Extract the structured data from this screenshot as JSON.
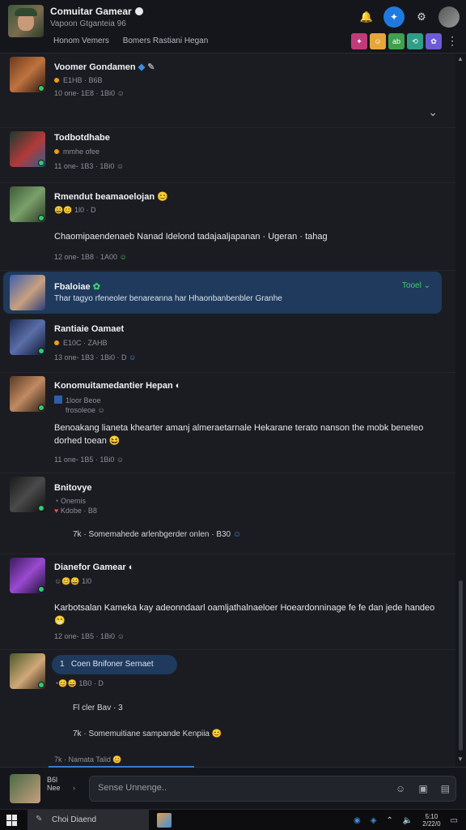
{
  "header": {
    "title": "Comuitar Gamear",
    "subtitle": "Vapoon Gtganteia 96",
    "tabs": [
      "Honom Vemers",
      "Bomers Rastiani Hegan"
    ],
    "apps": [
      {
        "label": "✦",
        "color": "#c13b7a"
      },
      {
        "label": "☺",
        "color": "#e6a63a"
      },
      {
        "label": "ab",
        "color": "#3fa14e"
      },
      {
        "label": "⟲",
        "color": "#2f9e86"
      },
      {
        "label": "✿",
        "color": "#6b5bd6"
      }
    ]
  },
  "messages": [
    {
      "name": "Voomer Gondamen",
      "meta": "E1HB · B6B",
      "time": "10 one- 1E8 · 1Bi0"
    },
    {
      "name": "Todbotdhabe",
      "meta": "mmhe ofee",
      "time": "11 one- 1B3 · 1Bi0"
    },
    {
      "name": "Rmendut beamaoelojan",
      "meta": "1l0 · D",
      "body": "Chaomipaendenaeb Nanad Idelond tadajaaljapanan · Ugeran · tahag",
      "time": "12 one- 1B8 · 1A00"
    },
    {
      "name": "Fbaloiae",
      "reply": "Thar tagyo rfeneoler benareanna har Hhaonbanbenbler Granhe",
      "reply_tag": "Tooel"
    },
    {
      "name": "Rantiaie Oamaet",
      "meta": "E10C · ZAHB",
      "time": "13 one- 1B3 · 1Bi0 · D"
    },
    {
      "name": "Konomuitamedantier Hepan",
      "meta_lines": [
        "1loor Beoe",
        "frosoleoe"
      ],
      "body": "Benoakang lianeta khearter amanj almeraetarnale Hekarane terato nanson the mobk beneteo dorhed toean",
      "time": "11 one- 1B5 · 1Bi0"
    },
    {
      "name": "Bnitovye",
      "meta_lines": [
        "Onemis",
        "Kdobe · B8"
      ],
      "reply": "Somemahede arlenbgerder onlen · B30"
    },
    {
      "name": "Dianefor Gamear",
      "meta": "1l0",
      "body": "Karbotsalan Kameka kay adeonndaarl oamljathalnaeloer Hoeardonninage fe fe dan jede handeo",
      "time": "12 one- 1B5 · 1Bi0"
    },
    {
      "name": "Coen Bnifoner Sernaet",
      "meta": "1B0 · D",
      "reply_lines": [
        "Fl cler Bav · 3",
        "Somemuitiane sampande Kenpiia"
      ],
      "time": "7k · Namata Talid"
    }
  ],
  "composer": {
    "user": "B6l",
    "user_sub": "Nee",
    "placeholder": "Sense Unnenge.."
  },
  "taskbar": {
    "search_label": "Choi Diaend",
    "clock_time": "5:10",
    "clock_date": "2/22/0"
  }
}
